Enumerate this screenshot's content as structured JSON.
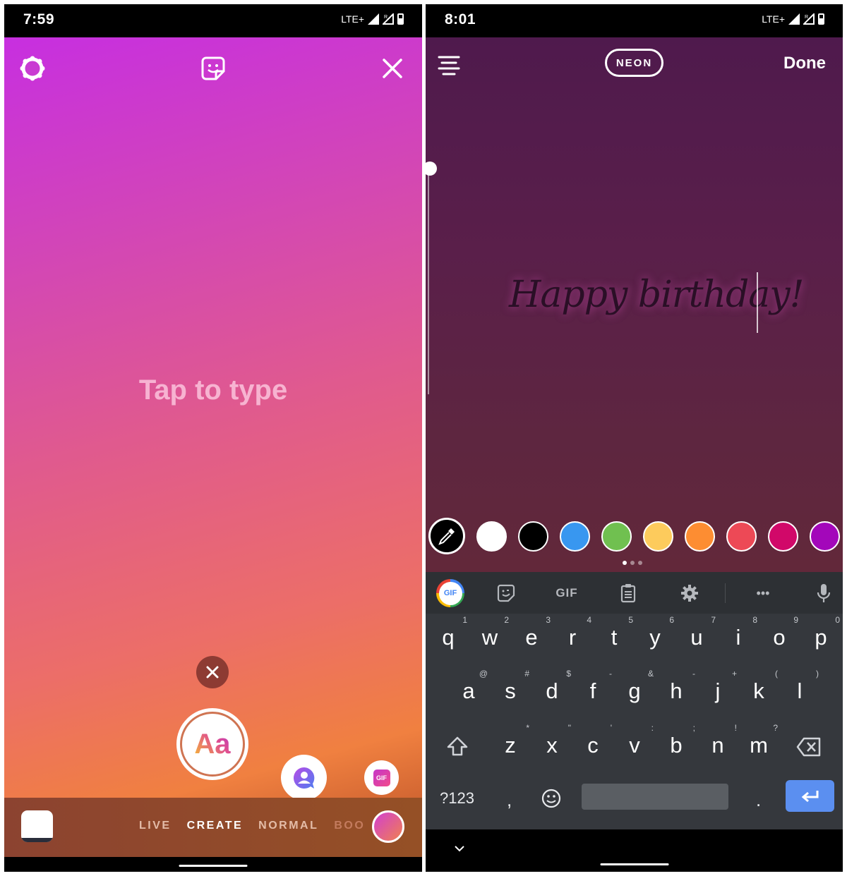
{
  "left_screen": {
    "status_bar": {
      "time": "7:59",
      "network": "LTE+"
    },
    "top_bar": {
      "settings_icon": "settings-gear-icon",
      "sticker_icon": "sticker-icon",
      "close_icon": "close-icon"
    },
    "placeholder": "Tap to type",
    "tools": {
      "dismiss_icon": "close-icon",
      "text_tool_label": "Aa",
      "mention_icon": "mention-avatar-icon",
      "gif_label": "GIF"
    },
    "modes": [
      {
        "label": "LIVE",
        "active": false
      },
      {
        "label": "CREATE",
        "active": true
      },
      {
        "label": "NORMAL",
        "active": false
      },
      {
        "label": "BOO",
        "active": false
      }
    ]
  },
  "right_screen": {
    "status_bar": {
      "time": "8:01",
      "network": "LTE+"
    },
    "top_bar": {
      "align_icon": "text-align-icon",
      "font_style_label": "NEON",
      "done_label": "Done"
    },
    "text_size_slider": {
      "value_fraction": 0.0
    },
    "typed_text": "Happy birthday!",
    "color_palette": {
      "picker_icon": "eyedropper-icon",
      "colors": [
        "#ffffff",
        "#000000",
        "#3897f0",
        "#70c050",
        "#fdcb5c",
        "#fd8d32",
        "#ed4956",
        "#d10869",
        "#a307ba"
      ],
      "page_count": 3,
      "current_page": 1
    },
    "keyboard": {
      "toolbar": {
        "gif_search_label": "GIF",
        "sticker_icon": "sticker-icon",
        "gif_label": "GIF",
        "clipboard_icon": "clipboard-icon",
        "settings_icon": "settings-icon",
        "more_label": "•••",
        "mic_icon": "microphone-icon"
      },
      "row1": [
        {
          "k": "q",
          "h": "1"
        },
        {
          "k": "w",
          "h": "2"
        },
        {
          "k": "e",
          "h": "3"
        },
        {
          "k": "r",
          "h": "4"
        },
        {
          "k": "t",
          "h": "5"
        },
        {
          "k": "y",
          "h": "6"
        },
        {
          "k": "u",
          "h": "7"
        },
        {
          "k": "i",
          "h": "8"
        },
        {
          "k": "o",
          "h": "9"
        },
        {
          "k": "p",
          "h": "0"
        }
      ],
      "row2": [
        {
          "k": "a",
          "h": "@"
        },
        {
          "k": "s",
          "h": "#"
        },
        {
          "k": "d",
          "h": "$"
        },
        {
          "k": "f",
          "h": "-"
        },
        {
          "k": "g",
          "h": "&"
        },
        {
          "k": "h",
          "h": "-"
        },
        {
          "k": "j",
          "h": "+"
        },
        {
          "k": "k",
          "h": "("
        },
        {
          "k": "l",
          "h": ")"
        }
      ],
      "row3": [
        {
          "k": "z",
          "h": "*"
        },
        {
          "k": "x",
          "h": "\""
        },
        {
          "k": "c",
          "h": "'"
        },
        {
          "k": "v",
          "h": ":"
        },
        {
          "k": "b",
          "h": ";"
        },
        {
          "k": "n",
          "h": "!"
        },
        {
          "k": "m",
          "h": "?"
        }
      ],
      "symbols_label": "?123",
      "comma": ",",
      "period": ".",
      "emoji_icon": "emoji-icon",
      "shift_icon": "shift-icon",
      "backspace_icon": "backspace-icon",
      "enter_icon": "enter-icon"
    }
  }
}
